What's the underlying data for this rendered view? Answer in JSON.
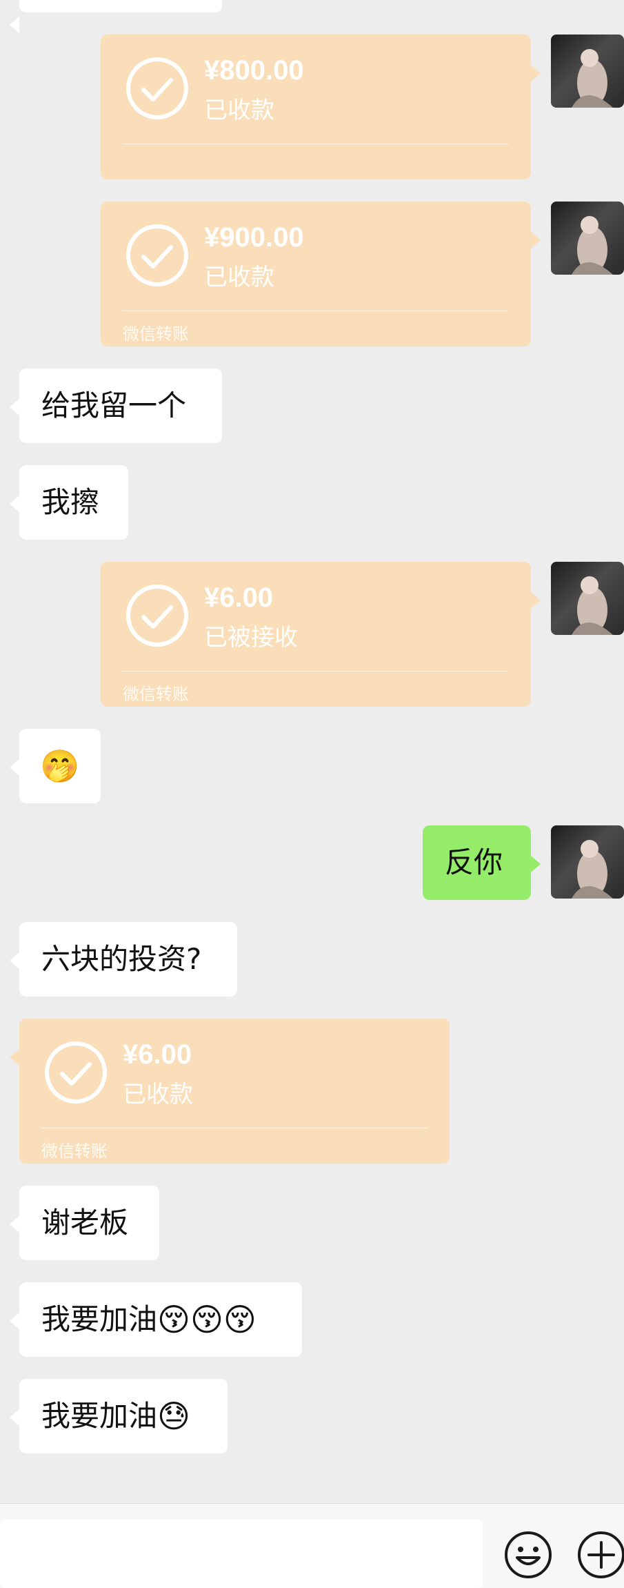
{
  "colors": {
    "background": "#ededed",
    "incoming_bubble": "#ffffff",
    "outgoing_bubble": "#95ec69",
    "transfer_card": "#f9deb9",
    "transfer_text": "#ffffff"
  },
  "messages": {
    "transfer_1": {
      "amount": "¥800.00",
      "status": "已收款",
      "footer": ""
    },
    "transfer_2": {
      "amount": "¥900.00",
      "status": "已收款",
      "footer": "微信转账"
    },
    "text_1": "给我留一个",
    "text_2": "我擦",
    "transfer_3": {
      "amount": "¥6.00",
      "status": "已被接收",
      "footer": "微信转账"
    },
    "emoji_1": "🤭",
    "out_text_1": "反你",
    "text_3": "六块的投资?",
    "transfer_4": {
      "amount": "¥6.00",
      "status": "已收款",
      "footer": "微信转账"
    },
    "text_4": "谢老板",
    "text_5": {
      "text": "我要加油",
      "emojis": "😚😚😚"
    },
    "text_6": {
      "text": "我要加油",
      "emojis": "😓"
    }
  },
  "toolbar": {
    "emoji_icon": "smile-icon",
    "plus_icon": "plus-icon"
  }
}
